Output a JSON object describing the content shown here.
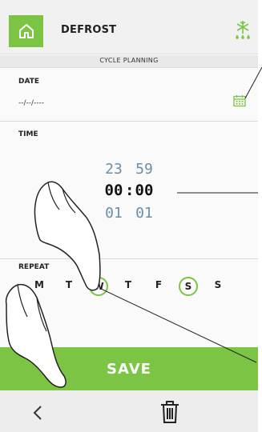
{
  "header": {
    "title": "DEFROST",
    "subtitle": "CYCLE PLANNING"
  },
  "date": {
    "label": "DATE",
    "value": "--/--/----"
  },
  "time": {
    "label": "TIME",
    "prev": {
      "hour": "23",
      "minute": "59"
    },
    "current": {
      "hour": "00",
      "separator": ":",
      "minute": "00"
    },
    "next": {
      "hour": "01",
      "minute": "01"
    }
  },
  "repeat": {
    "label": "REPEAT",
    "days": [
      {
        "label": "M",
        "selected": false
      },
      {
        "label": "T",
        "selected": false
      },
      {
        "label": "W",
        "selected": true
      },
      {
        "label": "T",
        "selected": false
      },
      {
        "label": "F",
        "selected": false
      },
      {
        "label": "S",
        "selected": true
      },
      {
        "label": "S",
        "selected": false
      }
    ]
  },
  "save_label": "SAVE",
  "colors": {
    "accent": "#7cc443",
    "time_dim": "#6b8ea6"
  },
  "icons": {
    "home": "home-icon",
    "defrost": "snowflake-drop-icon",
    "calendar": "calendar-icon",
    "back": "chevron-left-icon",
    "delete": "trash-icon"
  }
}
